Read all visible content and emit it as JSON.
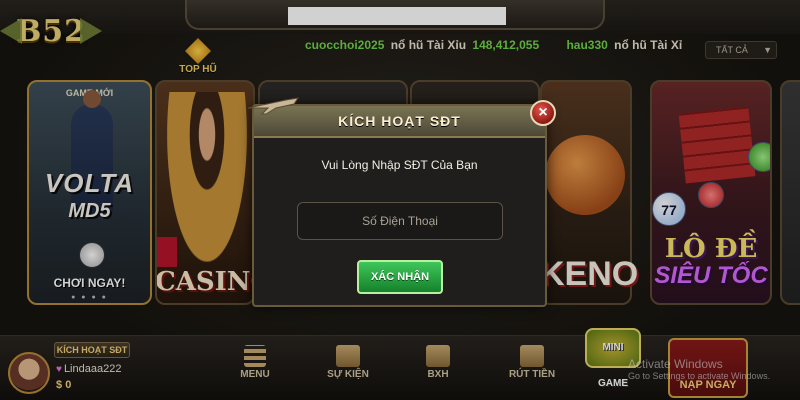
{
  "header": {
    "logo_text": "B52",
    "top_hu_label": "TOP HŨ",
    "filter": {
      "selected": "TẤT CẢ"
    },
    "ticker": [
      {
        "user": "cuocchoi2025",
        "text": "nổ hũ Tài Xỉu",
        "amount": "148,412,055"
      },
      {
        "user": "hau330",
        "text": "nổ hũ Tài Xỉ",
        "amount": ""
      }
    ]
  },
  "games": {
    "card1": {
      "badge": "GAME MỚI",
      "title": "VOLTA",
      "subtitle": "MD5",
      "cta": "CHƠI NGAY!",
      "dots": "● ● ● ●"
    },
    "card2": {
      "title": "CASINO"
    },
    "card5": {
      "title": "KENO"
    },
    "card6": {
      "title": "LÔ ĐỀ",
      "subtitle": "SIÊU TỐC",
      "ball_number": "77"
    }
  },
  "modal": {
    "title": "KÍCH HOẠT SĐT",
    "close_symbol": "×",
    "prompt": "Vui Lòng Nhập SĐT Của Bạn",
    "phone_placeholder": "Số Điện Thoại",
    "phone_value": "",
    "confirm_label": "XÁC NHẬN"
  },
  "user": {
    "activate_badge": "KÍCH HOẠT SĐT",
    "name_prefix": "♥",
    "name": "Lindaaa222",
    "currency": "$",
    "balance": "0"
  },
  "nav": {
    "menu": "MENU",
    "events": "SỰ KIỆN",
    "ranking": "BXH",
    "withdraw": "RÚT TIỀN",
    "minigame": "MINI GAME",
    "deposit": "NẠP NGAY"
  },
  "watermark": {
    "line1": "Activate Windows",
    "line2": "Go to Settings to activate Windows."
  },
  "icons": {
    "close": "close-icon",
    "plane": "plane-icon",
    "menu": "menu-icon",
    "events": "gift-icon",
    "ranking": "trophy-icon",
    "withdraw": "money-bag-icon"
  },
  "colors": {
    "confirm_green": "#15812c",
    "ticker_green": "#6fd34a",
    "gold": "#f2d07a",
    "close_red": "#c2261d"
  }
}
